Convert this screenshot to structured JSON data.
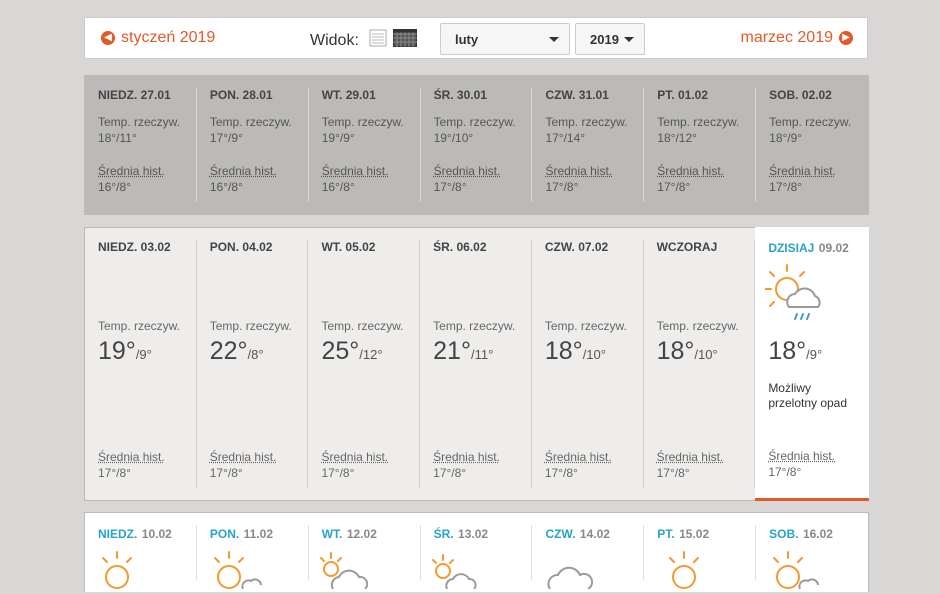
{
  "nav": {
    "prev_label": "styczeń 2019",
    "next_label": "marzec 2019",
    "view_label": "Widok:",
    "month_value": "luty",
    "year_value": "2019"
  },
  "colors": {
    "accent": "#e05a2a",
    "today_label": "#29a2c8",
    "sun": "#f39a2e",
    "cloud": "#9a9a9a",
    "rain": "#3a9fc1"
  },
  "labels": {
    "temp": "Temp. rzeczyw.",
    "hist": "Średnia hist."
  },
  "week1": [
    {
      "name": "NIEDZ. 27.01",
      "temp": "18°/11°",
      "hist": "16°/8°"
    },
    {
      "name": "PON. 28.01",
      "temp": "17°/9°",
      "hist": "16°/8°"
    },
    {
      "name": "WT. 29.01",
      "temp": "19°/9°",
      "hist": "16°/8°"
    },
    {
      "name": "ŚR. 30.01",
      "temp": "19°/10°",
      "hist": "17°/8°"
    },
    {
      "name": "CZW. 31.01",
      "temp": "17°/14°",
      "hist": "17°/8°"
    },
    {
      "name": "PT. 01.02",
      "temp": "18°/12°",
      "hist": "17°/8°"
    },
    {
      "name": "SOB. 02.02",
      "temp": "18°/9°",
      "hist": "17°/8°"
    }
  ],
  "week2": [
    {
      "name": "NIEDZ. 03.02",
      "high": "19°",
      "low": "/9°",
      "hist": "17°/8°"
    },
    {
      "name": "PON. 04.02",
      "high": "22°",
      "low": "/8°",
      "hist": "17°/8°"
    },
    {
      "name": "WT. 05.02",
      "high": "25°",
      "low": "/12°",
      "hist": "17°/8°"
    },
    {
      "name": "ŚR. 06.02",
      "high": "21°",
      "low": "/11°",
      "hist": "17°/8°"
    },
    {
      "name": "CZW. 07.02",
      "high": "18°",
      "low": "/10°",
      "hist": "17°/8°"
    },
    {
      "name": "WCZORAJ",
      "high": "18°",
      "low": "/10°",
      "hist": "17°/8°"
    }
  ],
  "today": {
    "label": "DZISIAJ",
    "date": "09.02",
    "high": "18°",
    "low": "/9°",
    "description": "Możliwy przelotny opad",
    "hist": "17°/8°",
    "icon": "partly-cloudy-rain-icon"
  },
  "week3": [
    {
      "day": "NIEDZ.",
      "date": "10.02",
      "icon": "sun-icon"
    },
    {
      "day": "PON.",
      "date": "11.02",
      "icon": "sun-cloud-icon"
    },
    {
      "day": "WT.",
      "date": "12.02",
      "icon": "partly-cloudy-icon"
    },
    {
      "day": "ŚR.",
      "date": "13.02",
      "icon": "partly-cloudy-icon"
    },
    {
      "day": "CZW.",
      "date": "14.02",
      "icon": "cloud-icon"
    },
    {
      "day": "PT.",
      "date": "15.02",
      "icon": "sun-icon"
    },
    {
      "day": "SOB.",
      "date": "16.02",
      "icon": "sun-cloud-icon"
    }
  ]
}
